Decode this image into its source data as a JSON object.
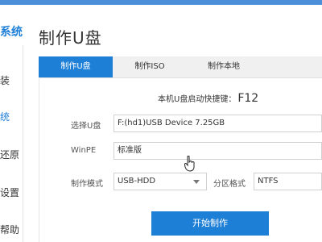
{
  "brand": "系统",
  "sidebar": {
    "items": [
      {
        "label": "装"
      },
      {
        "label": "统",
        "active": true
      },
      {
        "label": "还原"
      },
      {
        "label": "设置"
      },
      {
        "label": "帮助"
      }
    ]
  },
  "page_title": "制作U盘",
  "tabs": [
    {
      "label": "制作U盘",
      "active": true
    },
    {
      "label": "制作ISO"
    },
    {
      "label": "制作本地"
    }
  ],
  "hotkey": {
    "label": "本机U盘启动快捷键：",
    "key": "F12"
  },
  "form": {
    "select_usb": {
      "label": "选择U盘",
      "value": "F:(hd1)USB Device 7.25GB"
    },
    "winpe": {
      "label": "WinPE",
      "value": "标准版"
    },
    "mode": {
      "label": "制作模式",
      "value": "USB-HDD"
    },
    "partition": {
      "label": "分区格式",
      "value": "NTFS"
    }
  },
  "start_button": "开始制作",
  "colors": {
    "accent": "#1e7fd6",
    "tab_bg": "#f0f0f0"
  },
  "icons": {
    "cursor": "hand-pointer-icon",
    "dropdown": "caret-down-icon"
  }
}
